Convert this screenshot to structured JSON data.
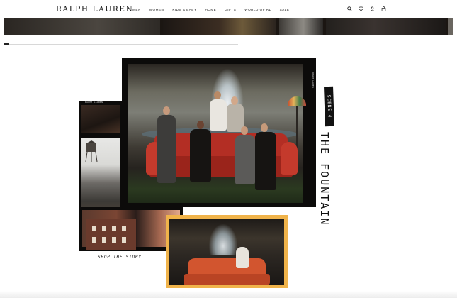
{
  "brand": {
    "logo": "RALPH LAUREN"
  },
  "nav": {
    "items": [
      "MEN",
      "WOMEN",
      "KIDS & BABY",
      "HOME",
      "GIFTS",
      "WORLD OF RL",
      "SALE"
    ]
  },
  "header_icons": [
    "search-icon",
    "heart-icon",
    "account-icon",
    "bag-icon"
  ],
  "carousel": {
    "progress": 0.02
  },
  "collage": {
    "scene_tag": "SCENE 4",
    "title": "THE FOUNTAIN",
    "film_label": "RALPH LAUREN",
    "shop_link": "SHOP THE STORY"
  },
  "colors": {
    "gold_frame": "#f0b34a",
    "sofa_red": "#b32e24",
    "text": "#111111"
  }
}
